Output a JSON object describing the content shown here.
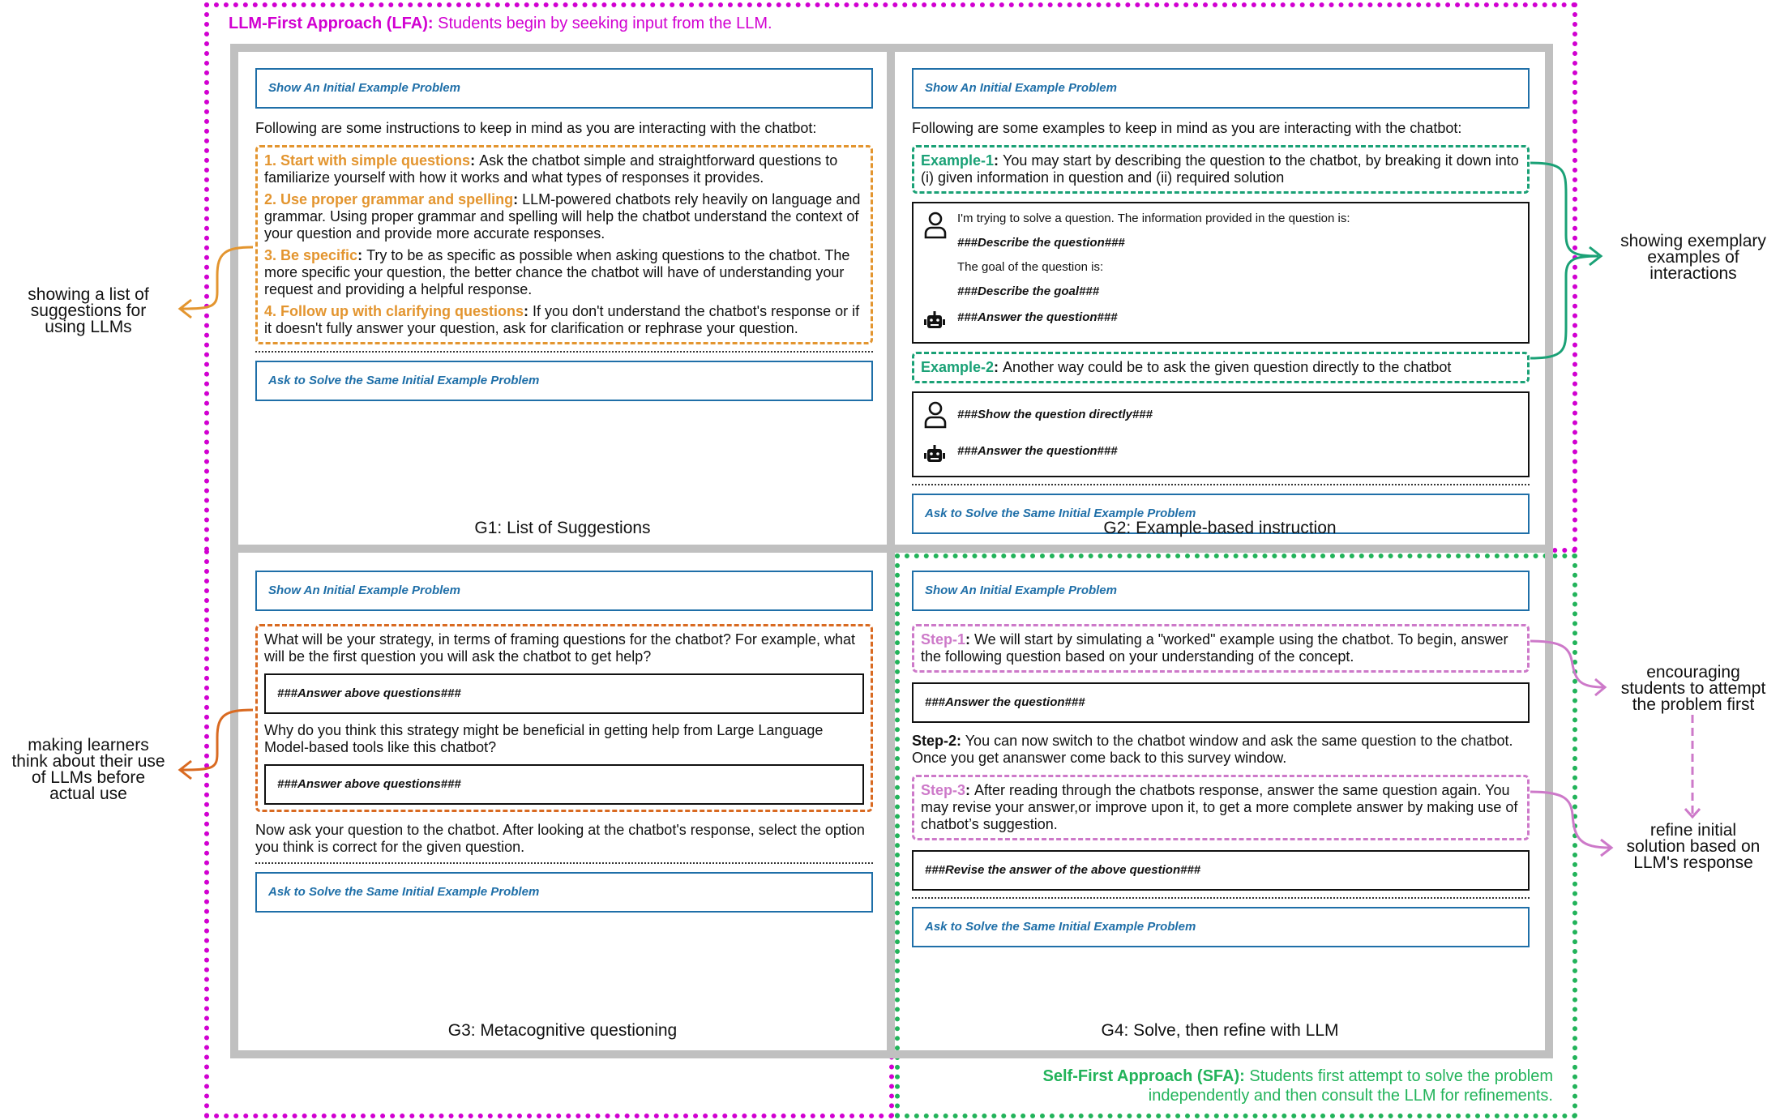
{
  "lfa": {
    "label": "LLM-First Approach (LFA):",
    "desc": "Students begin by seeking input from the LLM.",
    "color": "#d100d1"
  },
  "sfa": {
    "label": "Self-First Approach (SFA):",
    "desc_line1": "Students first attempt to solve the problem",
    "desc_line2": "independently and then consult the LLM for refinements.",
    "color": "#22b35a"
  },
  "common": {
    "show_button": "Show An Initial Example Problem",
    "ask_button": "Ask to Solve the Same Initial Example Problem"
  },
  "g1": {
    "caption": "G1: List of Suggestions",
    "intro": "Following are some instructions to keep in mind as you are interacting with the chatbot:",
    "items": [
      {
        "key": "1. Start with simple questions",
        "text": "Ask the chatbot simple and straightforward questions to familiarize yourself with how it works and what types of responses it provides."
      },
      {
        "key": "2. Use proper grammar and spelling",
        "text": "LLM-powered chatbots rely heavily on language and grammar. Using proper grammar and spelling will help the chatbot understand the context of your question and provide more accurate responses."
      },
      {
        "key": "3. Be specific",
        "text": "Try to be as specific as possible when asking questions to the chatbot. The more specific your question, the better chance the chatbot will have of understanding your request and providing a helpful response."
      },
      {
        "key": "4. Follow up with clarifying questions",
        "text": "If you don't understand the chatbot's response or if it doesn't fully answer your question, ask for clarification or rephrase your question."
      }
    ],
    "color": "#e3952f"
  },
  "g2": {
    "caption": "G2: Example-based instruction",
    "intro": "Following are some examples to keep in mind as you are interacting with the chatbot:",
    "example1": {
      "key": "Example-1",
      "text": "You may start by describing the question to the chatbot, by breaking it down into (i) given information in question and (ii) required solution"
    },
    "chat1": {
      "user_line1": "I'm trying to solve a question. The information provided in the question is:",
      "user_line2": "###Describe the question###",
      "user_line3": "The goal of the question is:",
      "user_line4": "###Describe the goal###",
      "bot": "###Answer the question###"
    },
    "example2": {
      "key": "Example-2",
      "text": "Another way could be to ask the given question directly to the chatbot"
    },
    "chat2": {
      "user": "###Show the question directly###",
      "bot": "###Answer the question###"
    },
    "color": "#1aa176"
  },
  "g3": {
    "caption": "G3: Metacognitive questioning",
    "q1": "What will be your strategy, in terms of framing questions for the chatbot? For example, what will be the first question you will ask the chatbot to get help?",
    "a1": "###Answer above questions###",
    "q2": "Why do you think this strategy might be beneficial in getting help from Large Language Model-based tools like this chatbot?",
    "a2": "###Answer above questions###",
    "after": "Now ask your question to the chatbot. After looking at the chatbot's response, select the option you think is correct for the given question.",
    "color": "#d96a21"
  },
  "g4": {
    "caption": "G4: Solve, then refine with LLM",
    "step1": {
      "key": "Step-1",
      "text": "We will start by simulating a \"worked\" example using the chatbot. To begin, answer the following question based on your understanding of the concept."
    },
    "a1": "###Answer the question###",
    "step2": {
      "key": "Step-2:",
      "text": "You can now switch to the chatbot window and ask the same question to the chatbot. Once you get ananswer come back to this survey window."
    },
    "step3": {
      "key": "Step-3",
      "text": "After reading through the chatbots response, answer the same question again. You may revise your answer,or improve upon it, to get a more complete answer by making use of chatbot’s suggestion."
    },
    "a3": "###Revise the answer of the above question###",
    "color": "#cd79c9"
  },
  "annotations": {
    "g1": [
      "showing a list of",
      "suggestions for",
      "using LLMs"
    ],
    "g2": [
      "showing exemplary",
      "examples of",
      "interactions"
    ],
    "g3": [
      "making learners",
      "think about their use",
      "of LLMs before",
      "actual use"
    ],
    "g4a": [
      "encouraging",
      "students to attempt",
      "the problem first"
    ],
    "g4b": [
      "refine initial",
      "solution based on",
      "LLM's response"
    ]
  }
}
